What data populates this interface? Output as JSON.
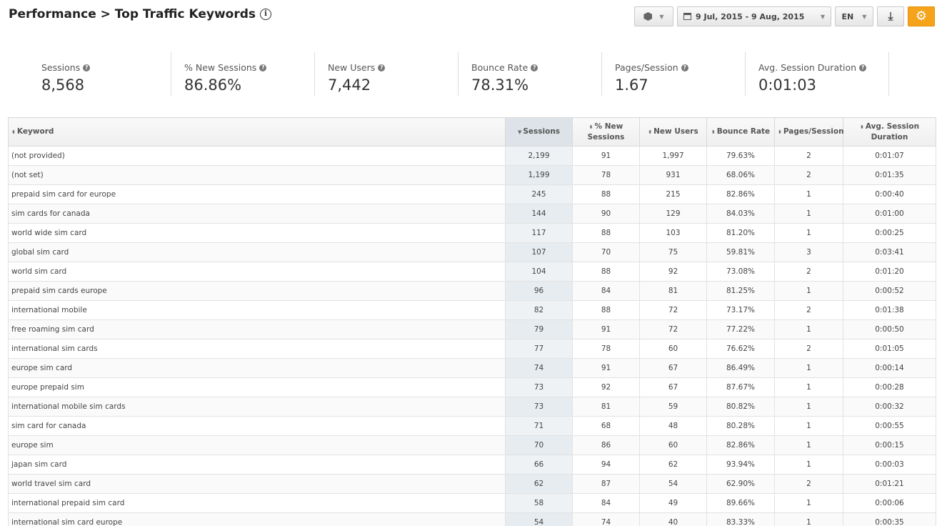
{
  "header": {
    "title": "Performance > Top Traffic Keywords",
    "info_glyph": "i"
  },
  "toolbar": {
    "date_range": "9 Jul, 2015 - 9 Aug, 2015",
    "language": "EN",
    "accent_color": "#f5a31a"
  },
  "kpis": [
    {
      "label": "Sessions",
      "value": "8,568"
    },
    {
      "label": "% New Sessions",
      "value": "86.86%"
    },
    {
      "label": "New Users",
      "value": "7,442"
    },
    {
      "label": "Bounce Rate",
      "value": "78.31%"
    },
    {
      "label": "Pages/Session",
      "value": "1.67"
    },
    {
      "label": "Avg. Session Duration",
      "value": "0:01:03"
    }
  ],
  "table": {
    "columns": [
      "Keyword",
      "Sessions",
      "% New Sessions",
      "New Users",
      "Bounce Rate",
      "Pages/Session",
      "Avg. Session Duration"
    ],
    "sorted_column": "Sessions",
    "rows": [
      [
        "(not provided)",
        "2,199",
        "91",
        "1,997",
        "79.63%",
        "2",
        "0:01:07"
      ],
      [
        "(not set)",
        "1,199",
        "78",
        "931",
        "68.06%",
        "2",
        "0:01:35"
      ],
      [
        "prepaid sim card for europe",
        "245",
        "88",
        "215",
        "82.86%",
        "1",
        "0:00:40"
      ],
      [
        "sim cards for canada",
        "144",
        "90",
        "129",
        "84.03%",
        "1",
        "0:01:00"
      ],
      [
        "world wide sim card",
        "117",
        "88",
        "103",
        "81.20%",
        "1",
        "0:00:25"
      ],
      [
        "global sim card",
        "107",
        "70",
        "75",
        "59.81%",
        "3",
        "0:03:41"
      ],
      [
        "world sim card",
        "104",
        "88",
        "92",
        "73.08%",
        "2",
        "0:01:20"
      ],
      [
        "prepaid sim cards europe",
        "96",
        "84",
        "81",
        "81.25%",
        "1",
        "0:00:52"
      ],
      [
        "international mobile",
        "82",
        "88",
        "72",
        "73.17%",
        "2",
        "0:01:38"
      ],
      [
        "free roaming sim card",
        "79",
        "91",
        "72",
        "77.22%",
        "1",
        "0:00:50"
      ],
      [
        "international sim cards",
        "77",
        "78",
        "60",
        "76.62%",
        "2",
        "0:01:05"
      ],
      [
        "europe sim card",
        "74",
        "91",
        "67",
        "86.49%",
        "1",
        "0:00:14"
      ],
      [
        "europe prepaid sim",
        "73",
        "92",
        "67",
        "87.67%",
        "1",
        "0:00:28"
      ],
      [
        "international mobile sim cards",
        "73",
        "81",
        "59",
        "80.82%",
        "1",
        "0:00:32"
      ],
      [
        "sim card for canada",
        "71",
        "68",
        "48",
        "80.28%",
        "1",
        "0:00:55"
      ],
      [
        "europe sim",
        "70",
        "86",
        "60",
        "82.86%",
        "1",
        "0:00:15"
      ],
      [
        "japan sim card",
        "66",
        "94",
        "62",
        "93.94%",
        "1",
        "0:00:03"
      ],
      [
        "world travel sim card",
        "62",
        "87",
        "54",
        "62.90%",
        "2",
        "0:01:21"
      ],
      [
        "international prepaid sim card",
        "58",
        "84",
        "49",
        "89.66%",
        "1",
        "0:00:06"
      ],
      [
        "international sim card europe",
        "54",
        "74",
        "40",
        "83.33%",
        "1",
        "0:00:35"
      ]
    ]
  }
}
